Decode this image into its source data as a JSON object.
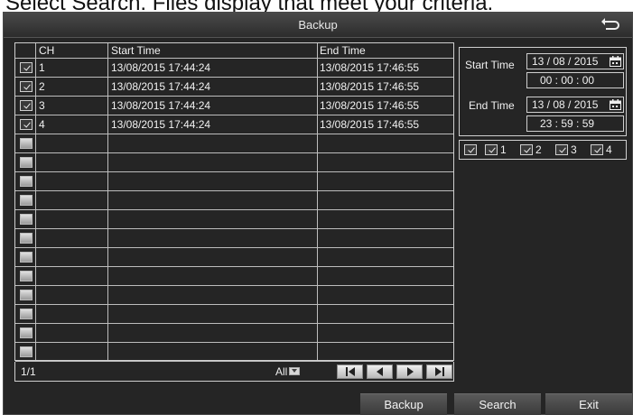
{
  "caption": "Select Search. Files display that meet your criteria.",
  "window": {
    "title": "Backup"
  },
  "table": {
    "headers": {
      "ch": "CH",
      "start": "Start Time",
      "end": "End Time"
    },
    "rows": [
      {
        "checked": true,
        "ch": "1",
        "start": "13/08/2015 17:44:24",
        "end": "13/08/2015 17:46:55"
      },
      {
        "checked": true,
        "ch": "2",
        "start": "13/08/2015 17:44:24",
        "end": "13/08/2015 17:46:55"
      },
      {
        "checked": true,
        "ch": "3",
        "start": "13/08/2015 17:44:24",
        "end": "13/08/2015 17:46:55"
      },
      {
        "checked": true,
        "ch": "4",
        "start": "13/08/2015 17:44:24",
        "end": "13/08/2015 17:46:55"
      },
      {
        "checked": false,
        "ch": "",
        "start": "",
        "end": ""
      },
      {
        "checked": false,
        "ch": "",
        "start": "",
        "end": ""
      },
      {
        "checked": false,
        "ch": "",
        "start": "",
        "end": ""
      },
      {
        "checked": false,
        "ch": "",
        "start": "",
        "end": ""
      },
      {
        "checked": false,
        "ch": "",
        "start": "",
        "end": ""
      },
      {
        "checked": false,
        "ch": "",
        "start": "",
        "end": ""
      },
      {
        "checked": false,
        "ch": "",
        "start": "",
        "end": ""
      },
      {
        "checked": false,
        "ch": "",
        "start": "",
        "end": ""
      },
      {
        "checked": false,
        "ch": "",
        "start": "",
        "end": ""
      },
      {
        "checked": false,
        "ch": "",
        "start": "",
        "end": ""
      },
      {
        "checked": false,
        "ch": "",
        "start": "",
        "end": ""
      },
      {
        "checked": false,
        "ch": "",
        "start": "",
        "end": ""
      }
    ]
  },
  "pager": {
    "page": "1/1",
    "filter": "All"
  },
  "search": {
    "start_label": "Start Time",
    "start_date": "13 / 08 / 2015",
    "start_time": "00  :  00  :  00",
    "end_label": "End Time",
    "end_date": "13 / 08 / 2015",
    "end_time": "23  :  59  :  59"
  },
  "channels": [
    "1",
    "2",
    "3",
    "4"
  ],
  "buttons": {
    "backup": "Backup",
    "search": "Search",
    "exit": "Exit"
  }
}
